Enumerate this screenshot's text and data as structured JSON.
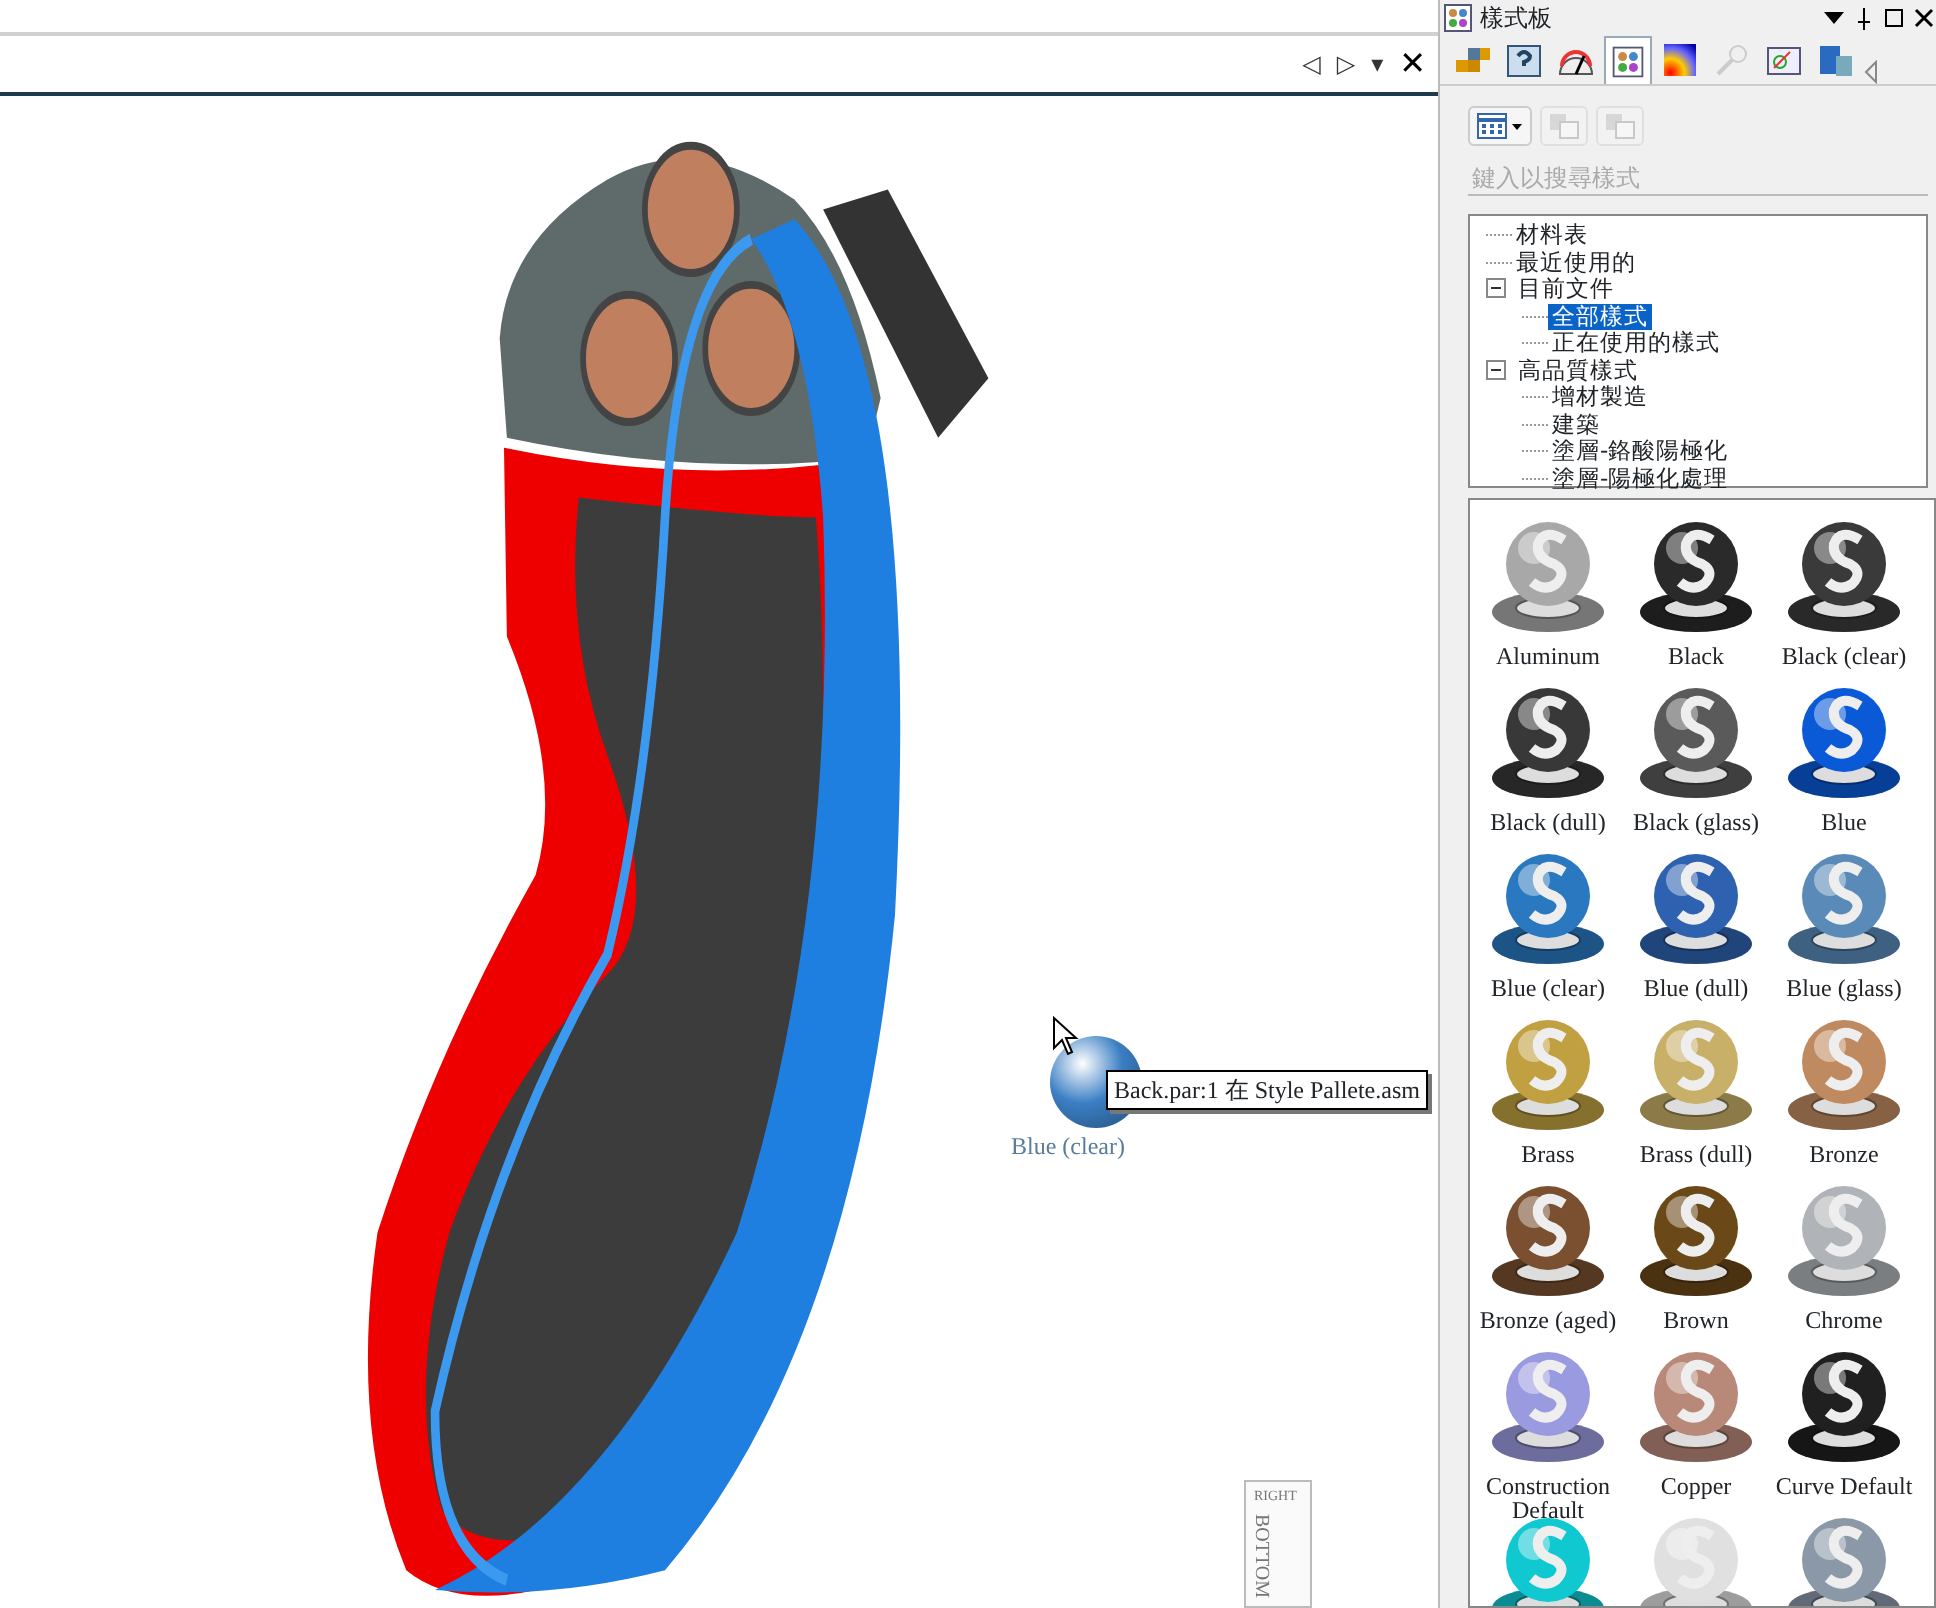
{
  "viewport": {
    "toolbar": {
      "buttons": [
        "◁",
        "▷",
        "▾",
        "✕"
      ]
    },
    "drag_preview": {
      "label": "Blue (clear)",
      "color": "#3b7fc4"
    },
    "tooltip": "Back.par:1 在 Style Pallete.asm",
    "view_cube": {
      "top_face": "RIGHT",
      "front_face": "BOTTOM"
    }
  },
  "style_palette": {
    "title": "樣式板",
    "tabs": [
      {
        "selected": false,
        "disabled": false
      },
      {
        "selected": false,
        "disabled": false
      },
      {
        "selected": false,
        "disabled": false
      },
      {
        "selected": true,
        "disabled": false
      },
      {
        "selected": false,
        "disabled": false
      },
      {
        "selected": false,
        "disabled": true
      },
      {
        "selected": false,
        "disabled": false
      },
      {
        "selected": false,
        "disabled": false
      }
    ],
    "search": {
      "placeholder": "鍵入以搜尋樣式"
    },
    "tree": [
      {
        "label": "材料表",
        "selected": false
      },
      {
        "label": "最近使用的",
        "selected": false
      },
      {
        "label": "目前文件",
        "selected": false,
        "expanded": true,
        "children": [
          {
            "label": "全部樣式",
            "selected": true
          },
          {
            "label": "正在使用的樣式",
            "selected": false
          }
        ]
      },
      {
        "label": "高品質樣式",
        "selected": false,
        "expanded": true,
        "children": [
          {
            "label": "增材製造",
            "selected": false
          },
          {
            "label": "建築",
            "selected": false
          },
          {
            "label": "塗層-鉻酸陽極化",
            "selected": false
          },
          {
            "label": "塗層-陽極化處理",
            "selected": false
          }
        ]
      }
    ],
    "materials": [
      {
        "label": "Aluminum",
        "color": "#a8a8a8"
      },
      {
        "label": "Black",
        "color": "#2a2a2a"
      },
      {
        "label": "Black (clear)",
        "color": "#3a3a3a"
      },
      {
        "label": "Black (dull)",
        "color": "#383838"
      },
      {
        "label": "Black (glass)",
        "color": "#5a5a5a"
      },
      {
        "label": "Blue",
        "color": "#0a5ad8"
      },
      {
        "label": "Blue (clear)",
        "color": "#2a78c0"
      },
      {
        "label": "Blue (dull)",
        "color": "#2e62b0"
      },
      {
        "label": "Blue (glass)",
        "color": "#5a8ab8"
      },
      {
        "label": "Brass",
        "color": "#c0a040"
      },
      {
        "label": "Brass (dull)",
        "color": "#c8b068"
      },
      {
        "label": "Bronze",
        "color": "#c08a60"
      },
      {
        "label": "Bronze (aged)",
        "color": "#7a5030"
      },
      {
        "label": "Brown",
        "color": "#6a4818"
      },
      {
        "label": "Chrome",
        "color": "#b0b4b8"
      },
      {
        "label": "Construction Default",
        "color": "#9a9ae0"
      },
      {
        "label": "Copper",
        "color": "#b88878"
      },
      {
        "label": "Curve Default",
        "color": "#202020"
      },
      {
        "color": "#10c8d0"
      },
      {
        "color": "#e0e0e0"
      },
      {
        "color": "#8a98a8"
      }
    ]
  }
}
